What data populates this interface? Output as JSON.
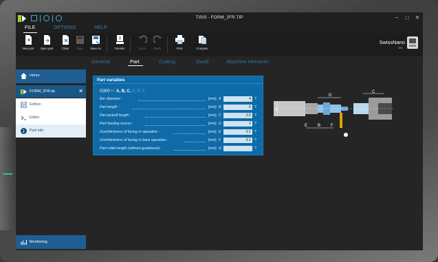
{
  "app": {
    "title": "TISIS - FORM_2FR.TIP"
  },
  "window_controls": {
    "minimize": "–",
    "maximize": "□",
    "close": "✕"
  },
  "menu": [
    {
      "label": "FILE",
      "active": true
    },
    {
      "label": "OPTIONS",
      "active": false
    },
    {
      "label": "HELP",
      "active": false
    }
  ],
  "ribbon": [
    {
      "label": "New part",
      "icon": "new-part-icon",
      "disabled": false
    },
    {
      "label": "Open part",
      "icon": "open-part-icon",
      "disabled": false
    },
    {
      "label": "Close",
      "icon": "close-part-icon",
      "disabled": false
    },
    {
      "label": "Save",
      "icon": "save-icon",
      "disabled": true
    },
    {
      "label": "Save As",
      "icon": "save-as-icon",
      "disabled": false
    },
    {
      "label": "Transfer",
      "icon": "transfer-icon",
      "disabled": false
    },
    {
      "label": "Undo",
      "icon": "undo-icon",
      "disabled": true
    },
    {
      "label": "Redo",
      "icon": "redo-icon",
      "disabled": true
    },
    {
      "label": "Print",
      "icon": "print-icon",
      "disabled": false
    },
    {
      "label": "Compare",
      "icon": "compare-icon",
      "disabled": false
    }
  ],
  "brand": {
    "name": "SwissNano",
    "sub": "SN"
  },
  "subtabs": [
    {
      "label": "General",
      "active": false
    },
    {
      "label": "Part",
      "active": true
    },
    {
      "label": "Cutting",
      "active": false
    },
    {
      "label": "Dwell",
      "active": false
    },
    {
      "label": "Machine elements",
      "active": false
    }
  ],
  "sidebar": {
    "home": "Home",
    "file": "FORM_2FR.tip",
    "file_close": "✕",
    "items": [
      {
        "label": "Edition",
        "icon": "edition-icon",
        "active": false
      },
      {
        "label": "Editor",
        "icon": "editor-icon",
        "active": false
      },
      {
        "label": "Part info",
        "icon": "info-icon",
        "active": true
      }
    ],
    "monitoring": "Monitoring"
  },
  "panel": {
    "title": "Part variables",
    "gcode": {
      "prefix": "G300",
      "parts": [
        "H,",
        "A,",
        "B,",
        "C,",
        "D,",
        "E,",
        "F,"
      ]
    },
    "rows": [
      {
        "label": "Bar diameter :",
        "unit": "[mm]",
        "key": "A",
        "value": "4",
        "help": "?"
      },
      {
        "label": "Part length :",
        "unit": "[mm]",
        "key": "B",
        "value": "6",
        "help": "?"
      },
      {
        "label": "Part pickoff length :",
        "unit": "[mm]",
        "key": "C",
        "value": "2.5",
        "help": "?"
      },
      {
        "label": "Part feeding recess :",
        "unit": "[mm]",
        "key": "D",
        "value": "2",
        "help": "?"
      },
      {
        "label": "Overthickness of facing in operation :",
        "unit": "[mm]",
        "key": "E",
        "value": "0.1",
        "help": "?"
      },
      {
        "label": "Overthickness of facing in back operation :",
        "unit": "[mm]",
        "key": "F",
        "value": "0.1",
        "help": "?"
      },
      {
        "label": "Part collet length (without guidebush) :",
        "unit": "[mm]",
        "key": "H",
        "value": "",
        "help": "?"
      }
    ]
  },
  "diagram": {
    "labels": [
      "A",
      "D",
      "C",
      "E",
      "B",
      "F"
    ]
  },
  "colors": {
    "accent": "#0f6aa8",
    "sidebar_blue": "#1e5e93",
    "menu_blue": "#2e84c6",
    "orange_tool": "#e0a100"
  }
}
